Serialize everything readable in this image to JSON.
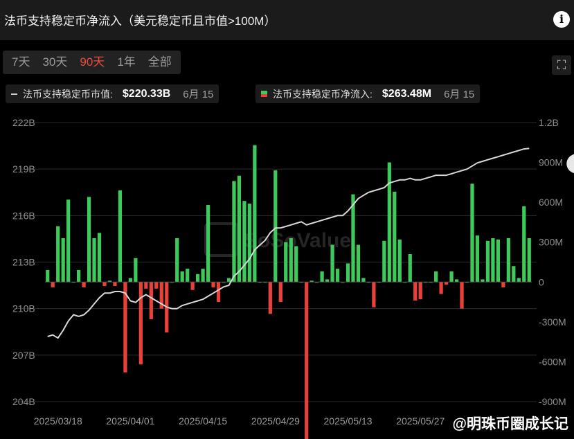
{
  "header": {
    "title": "法币支持稳定币净流入（美元稳定币且市值>100M）",
    "info_icon": "info-icon"
  },
  "tabs": [
    {
      "label": "7天",
      "active": false
    },
    {
      "label": "30天",
      "active": false
    },
    {
      "label": "90天",
      "active": true
    },
    {
      "label": "1年",
      "active": false
    },
    {
      "label": "全部",
      "active": false
    }
  ],
  "legend": {
    "market_cap": {
      "name": "法币支持稳定币市值:",
      "value": "$220.33B",
      "date": "6月 15"
    },
    "net_inflow": {
      "name": "法币支持稳定币净流入:",
      "value": "$263.48M",
      "date": "6月 15"
    }
  },
  "watermark": {
    "brand": "SoSoValue",
    "handle": "@明珠币圈成长记"
  },
  "colors": {
    "positive": "#3ec95b",
    "negative": "#e8413a",
    "line": "#d9d9d9",
    "active_tab": "#f04b3a"
  },
  "chart_data": {
    "type": "bar+line",
    "left_axis": {
      "ticks": [
        "222B",
        "219B",
        "216B",
        "213B",
        "210B",
        "207B",
        "204B"
      ],
      "range": [
        204,
        222
      ],
      "unit": "B"
    },
    "right_axis": {
      "ticks": [
        "1.2B",
        "900M",
        "600M",
        "300M",
        "0",
        "-300M",
        "-600M",
        "-900M"
      ],
      "range": [
        -900,
        1200
      ],
      "unit": "M"
    },
    "x_ticks": [
      "2025/03/18",
      "2025/04/01",
      "2025/04/15",
      "2025/04/29",
      "2025/05/13",
      "2025/05/27"
    ],
    "dates_start": "2025/03/18",
    "net_inflow_M": [
      90,
      -40,
      420,
      330,
      620,
      0,
      90,
      -40,
      640,
      330,
      370,
      -30,
      10,
      -30,
      690,
      -680,
      30,
      180,
      -620,
      -50,
      -280,
      -50,
      -200,
      -380,
      0,
      330,
      80,
      100,
      -60,
      60,
      100,
      580,
      -40,
      -150,
      0,
      30,
      760,
      800,
      610,
      590,
      1030,
      0,
      0,
      -240,
      840,
      -150,
      300,
      330,
      270,
      0,
      -1220,
      10,
      0,
      80,
      20,
      280,
      100,
      0,
      140,
      660,
      280,
      30,
      0,
      -190,
      0,
      310,
      900,
      680,
      320,
      0,
      210,
      -140,
      -130,
      0,
      0,
      80,
      -90,
      -20,
      80,
      20,
      -200,
      0,
      740,
      350,
      20,
      310,
      330,
      320,
      -40,
      330,
      120,
      30,
      570,
      330
    ],
    "market_cap_B": [
      208.2,
      208.3,
      208.1,
      208.6,
      209.2,
      209.6,
      209.5,
      209.6,
      209.9,
      210.3,
      210.7,
      211.0,
      211.0,
      211.1,
      211.1,
      211.0,
      210.5,
      210.4,
      210.7,
      210.9,
      210.7,
      210.5,
      210.3,
      210.1,
      210.0,
      210.0,
      210.2,
      210.3,
      210.4,
      210.5,
      210.6,
      210.8,
      211.0,
      211.2,
      211.4,
      211.5,
      212.1,
      212.4,
      212.8,
      213.2,
      213.8,
      214.1,
      214.4,
      214.9,
      215.2,
      215.2,
      215.3,
      215.4,
      215.5,
      215.6,
      215.4,
      215.5,
      215.6,
      215.7,
      215.8,
      215.9,
      216.0,
      216.0,
      216.3,
      216.7,
      217.1,
      217.3,
      217.5,
      217.6,
      217.7,
      217.8,
      218.1,
      218.2,
      218.3,
      218.3,
      218.4,
      218.3,
      218.3,
      218.4,
      218.5,
      218.6,
      218.6,
      218.6,
      218.7,
      218.8,
      218.9,
      219.0,
      219.2,
      219.4,
      219.5,
      219.6,
      219.7,
      219.8,
      219.9,
      220.0,
      220.1,
      220.2,
      220.3,
      220.33
    ]
  }
}
